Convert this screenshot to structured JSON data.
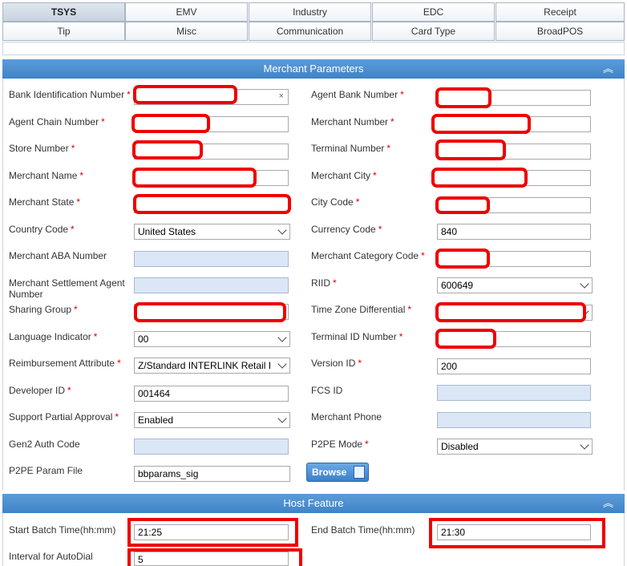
{
  "tabs_row1": [
    "TSYS",
    "EMV",
    "Industry",
    "EDC",
    "Receipt"
  ],
  "tabs_row2": [
    "Tip",
    "Misc",
    "Communication",
    "Card Type",
    "BroadPOS"
  ],
  "sections": {
    "merchant": "Merchant Parameters",
    "host": "Host Feature"
  },
  "labels": {
    "bin": "Bank Identification Number",
    "agent_bank": "Agent Bank Number",
    "agent_chain": "Agent Chain Number",
    "merchant_number": "Merchant Number",
    "store_number": "Store Number",
    "terminal_number": "Terminal Number",
    "merchant_name": "Merchant Name",
    "merchant_city": "Merchant City",
    "merchant_state": "Merchant State",
    "city_code": "City Code",
    "country_code": "Country Code",
    "currency_code": "Currency Code",
    "merchant_aba": "Merchant ABA Number",
    "merchant_category": "Merchant Category Code",
    "settlement_agent_line1": "Merchant Settlement Agent",
    "settlement_agent_line2": "Number",
    "riid": "RIID",
    "sharing_group": "Sharing Group",
    "time_zone": "Time Zone Differential",
    "language": "Language Indicator",
    "terminal_id": "Terminal ID Number",
    "reimbursement": "Reimbursement Attribute",
    "version_id": "Version ID",
    "developer_id": "Developer ID",
    "fcs_id": "FCS ID",
    "support_partial": "Support Partial Approval",
    "merchant_phone": "Merchant Phone",
    "gen2": "Gen2 Auth Code",
    "p2pe_mode": "P2PE Mode",
    "p2pe_param": "P2PE Param File",
    "start_batch": "Start Batch Time(hh:mm)",
    "end_batch": "End Batch Time(hh:mm)",
    "interval_autodial": "Interval for AutoDial"
  },
  "required_mark": "*",
  "values": {
    "country_code": "United States",
    "currency_code": "840",
    "riid": "600649",
    "language": "00",
    "reimbursement": "Z/Standard INTERLINK Retail I",
    "version_id": "200",
    "developer_id": "001464",
    "support_partial": "Enabled",
    "p2pe_mode": "Disabled",
    "p2pe_param": "bbparams_sig",
    "start_batch": "21:25",
    "end_batch": "21:30",
    "interval_autodial": "5"
  },
  "browse_label": "Browse",
  "clear_glyph": "×",
  "collapse_glyph": "︽",
  "colors": {
    "header": "#4a8fd0",
    "redaction": "#e00000",
    "required": "#dd0000",
    "field_blue": "#dbe7f7"
  }
}
